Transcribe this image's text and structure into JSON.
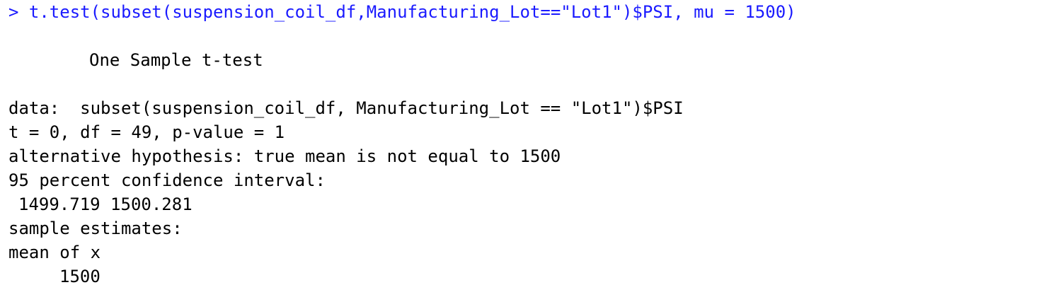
{
  "console": {
    "prompt": "> ",
    "command": "t.test(subset(suspension_coil_df,Manufacturing_Lot==\"Lot1\")$PSI, mu = 1500)",
    "test_title": "One Sample t-test",
    "data_line": "data:  subset(suspension_coil_df, Manufacturing_Lot == \"Lot1\")$PSI",
    "stats_line": "t = 0, df = 49, p-value = 1",
    "alternative_line": "alternative hypothesis: true mean is not equal to 1500",
    "ci_label": "95 percent confidence interval:",
    "ci_values": "1499.719 1500.281",
    "estimates_label": "sample estimates:",
    "estimate_name": "mean of x",
    "estimate_value": "1500"
  },
  "colors": {
    "input_text": "#1a1aff",
    "output_text": "#000000",
    "background": "#ffffff"
  }
}
